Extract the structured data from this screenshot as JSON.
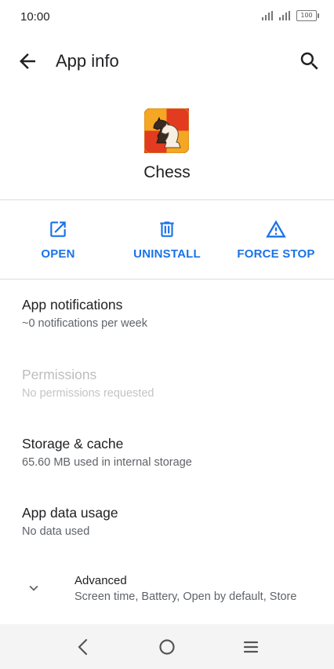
{
  "status": {
    "time": "10:00",
    "battery": "100"
  },
  "header": {
    "title": "App info",
    "back_icon": "back-arrow-icon",
    "search_icon": "search-icon"
  },
  "app": {
    "name": "Chess",
    "icon": "chess-app-icon",
    "icon_colors": {
      "primary": "#f5a623",
      "accent": "#e33b1f"
    }
  },
  "actions": [
    {
      "label": "OPEN",
      "icon": "open-external-icon"
    },
    {
      "label": "UNINSTALL",
      "icon": "trash-icon"
    },
    {
      "label": "FORCE STOP",
      "icon": "warning-icon"
    }
  ],
  "settings": [
    {
      "title": "App notifications",
      "subtitle": "~0 notifications per week",
      "enabled": true
    },
    {
      "title": "Permissions",
      "subtitle": "No permissions requested",
      "enabled": false
    },
    {
      "title": "Storage & cache",
      "subtitle": "65.60 MB used in internal storage",
      "enabled": true
    },
    {
      "title": "App data usage",
      "subtitle": "No data used",
      "enabled": true
    }
  ],
  "advanced": {
    "title": "Advanced",
    "subtitle": "Screen time, Battery, Open by default, Store"
  },
  "navbar": {
    "buttons": [
      "back-nav-icon",
      "home-nav-icon",
      "recents-menu-icon"
    ]
  },
  "colors": {
    "accent": "#1a73e8",
    "text": "#202124",
    "secondary_text": "#5f6368",
    "disabled_text": "#bdbdbd"
  }
}
